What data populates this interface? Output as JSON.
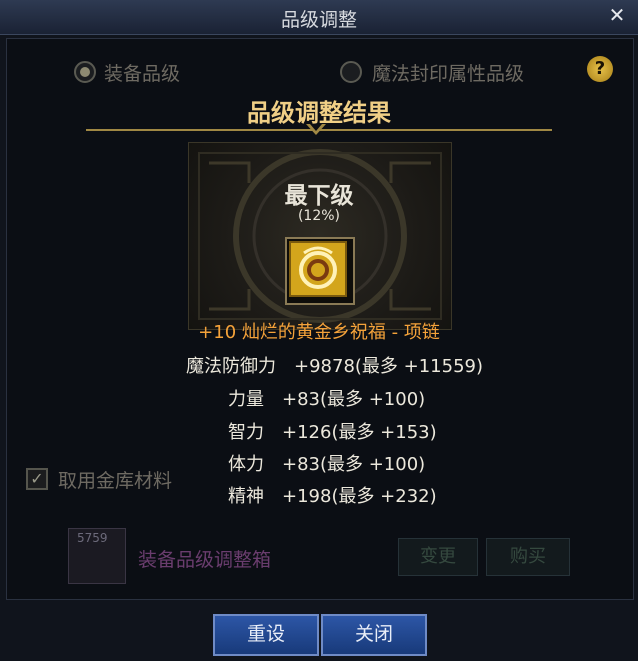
{
  "window": {
    "title": "品级调整",
    "close_symbol": "✕"
  },
  "background": {
    "radio_equipment": "装备品级",
    "radio_magic": "魔法封印属性品级",
    "help_symbol": "?",
    "use_vault_label": "取用金库材料",
    "material_count": "5759",
    "material_name": "装备品级调整箱",
    "change_label": "变更",
    "buy_label": "购买"
  },
  "result": {
    "header": "品级调整结果",
    "rank": "最下级",
    "percent": "(12%)",
    "item_name": "+10 灿烂的黄金乡祝福 - 项链",
    "stats": [
      {
        "label": "魔法防御力",
        "value": "+9878(最多 +11559)"
      },
      {
        "label": "力量",
        "value": "+83(最多 +100)"
      },
      {
        "label": "智力",
        "value": "+126(最多 +153)"
      },
      {
        "label": "体力",
        "value": "+83(最多 +100)"
      },
      {
        "label": "精神",
        "value": "+198(最多 +232)"
      }
    ]
  },
  "buttons": {
    "reset": "重设",
    "close": "关闭"
  },
  "colors": {
    "accent_gold": "#f0cf86",
    "item_orange": "#f4a23a",
    "button_blue": "#2d56a6"
  }
}
